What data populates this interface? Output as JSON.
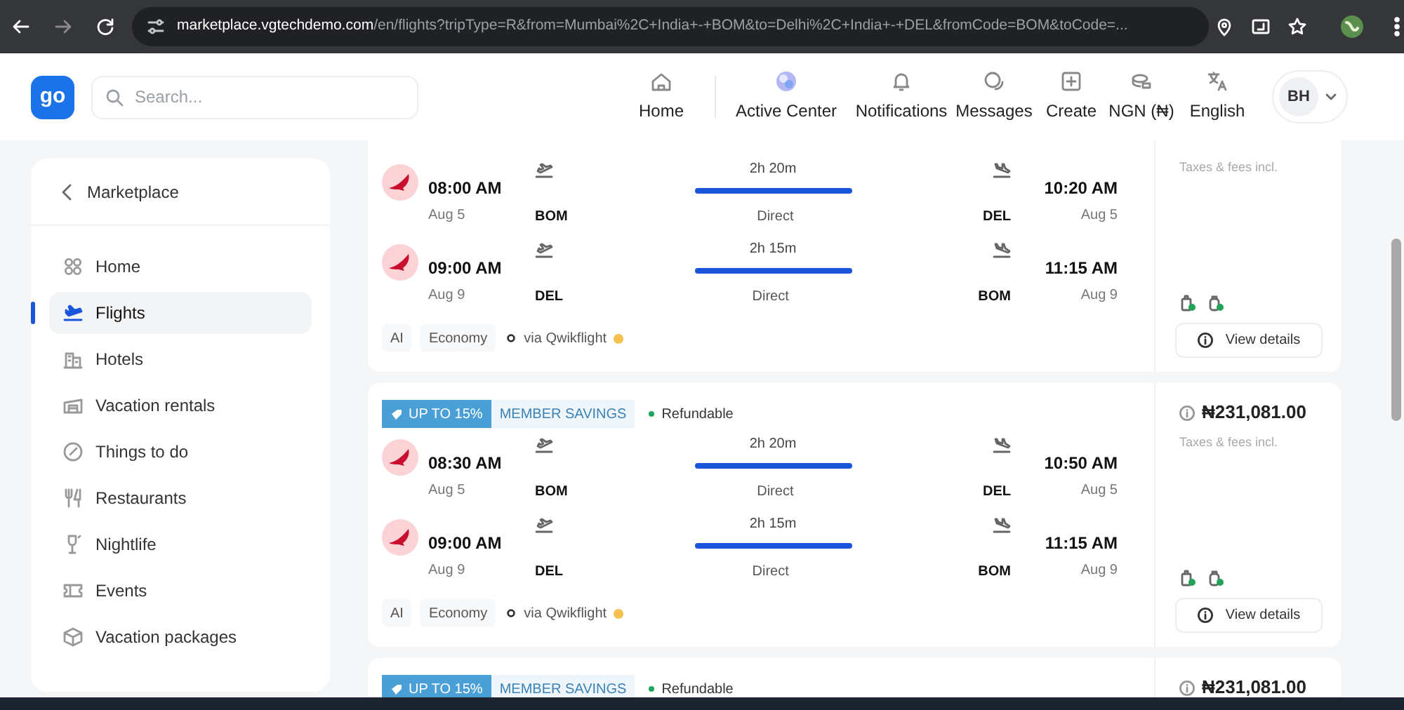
{
  "browser": {
    "url_host": "marketplace.vgtechdemo.com",
    "url_path": "/en/flights?tripType=R&from=Mumbai%2C+India+-+BOM&to=Delhi%2C+India+-+DEL&fromCode=BOM&toCode=..."
  },
  "header": {
    "logo": "go",
    "search_placeholder": "Search...",
    "avatar": "BH",
    "nav": [
      {
        "label": "Home"
      },
      {
        "label": "Active Center"
      },
      {
        "label": "Notifications"
      },
      {
        "label": "Messages"
      },
      {
        "label": "Create"
      },
      {
        "label": "NGN (₦)"
      },
      {
        "label": "English"
      }
    ]
  },
  "sidebar": {
    "back": "Marketplace",
    "items": [
      {
        "label": "Home",
        "selected": false
      },
      {
        "label": "Flights",
        "selected": true
      },
      {
        "label": "Hotels",
        "selected": false
      },
      {
        "label": "Vacation rentals",
        "selected": false
      },
      {
        "label": "Things to do",
        "selected": false
      },
      {
        "label": "Restaurants",
        "selected": false
      },
      {
        "label": "Nightlife",
        "selected": false
      },
      {
        "label": "Events",
        "selected": false
      },
      {
        "label": "Vacation packages",
        "selected": false
      }
    ]
  },
  "results": [
    {
      "price_note": "Taxes & fees incl.",
      "segments": [
        {
          "depart_time": "08:00 AM",
          "depart_date": "Aug 5",
          "from": "BOM",
          "duration": "2h 20m",
          "stops": "Direct",
          "to": "DEL",
          "arrive_time": "10:20 AM",
          "arrive_date": "Aug 5"
        },
        {
          "depart_time": "09:00 AM",
          "depart_date": "Aug 9",
          "from": "DEL",
          "duration": "2h 15m",
          "stops": "Direct",
          "to": "BOM",
          "arrive_time": "11:15 AM",
          "arrive_date": "Aug 9"
        }
      ],
      "tags": [
        "AI",
        "Economy"
      ],
      "provider": "via Qwikflight",
      "button": "View details"
    },
    {
      "badges": {
        "discount": "UP TO 15%",
        "savings": "MEMBER SAVINGS",
        "refundable": "Refundable"
      },
      "price": "₦231,081.00",
      "price_note": "Taxes & fees incl.",
      "segments": [
        {
          "depart_time": "08:30 AM",
          "depart_date": "Aug 5",
          "from": "BOM",
          "duration": "2h 20m",
          "stops": "Direct",
          "to": "DEL",
          "arrive_time": "10:50 AM",
          "arrive_date": "Aug 5"
        },
        {
          "depart_time": "09:00 AM",
          "depart_date": "Aug 9",
          "from": "DEL",
          "duration": "2h 15m",
          "stops": "Direct",
          "to": "BOM",
          "arrive_time": "11:15 AM",
          "arrive_date": "Aug 9"
        }
      ],
      "tags": [
        "AI",
        "Economy"
      ],
      "provider": "via Qwikflight",
      "button": "View details"
    },
    {
      "badges": {
        "discount": "UP TO 15%",
        "savings": "MEMBER SAVINGS",
        "refundable": "Refundable"
      },
      "price": "₦231,081.00"
    }
  ]
}
